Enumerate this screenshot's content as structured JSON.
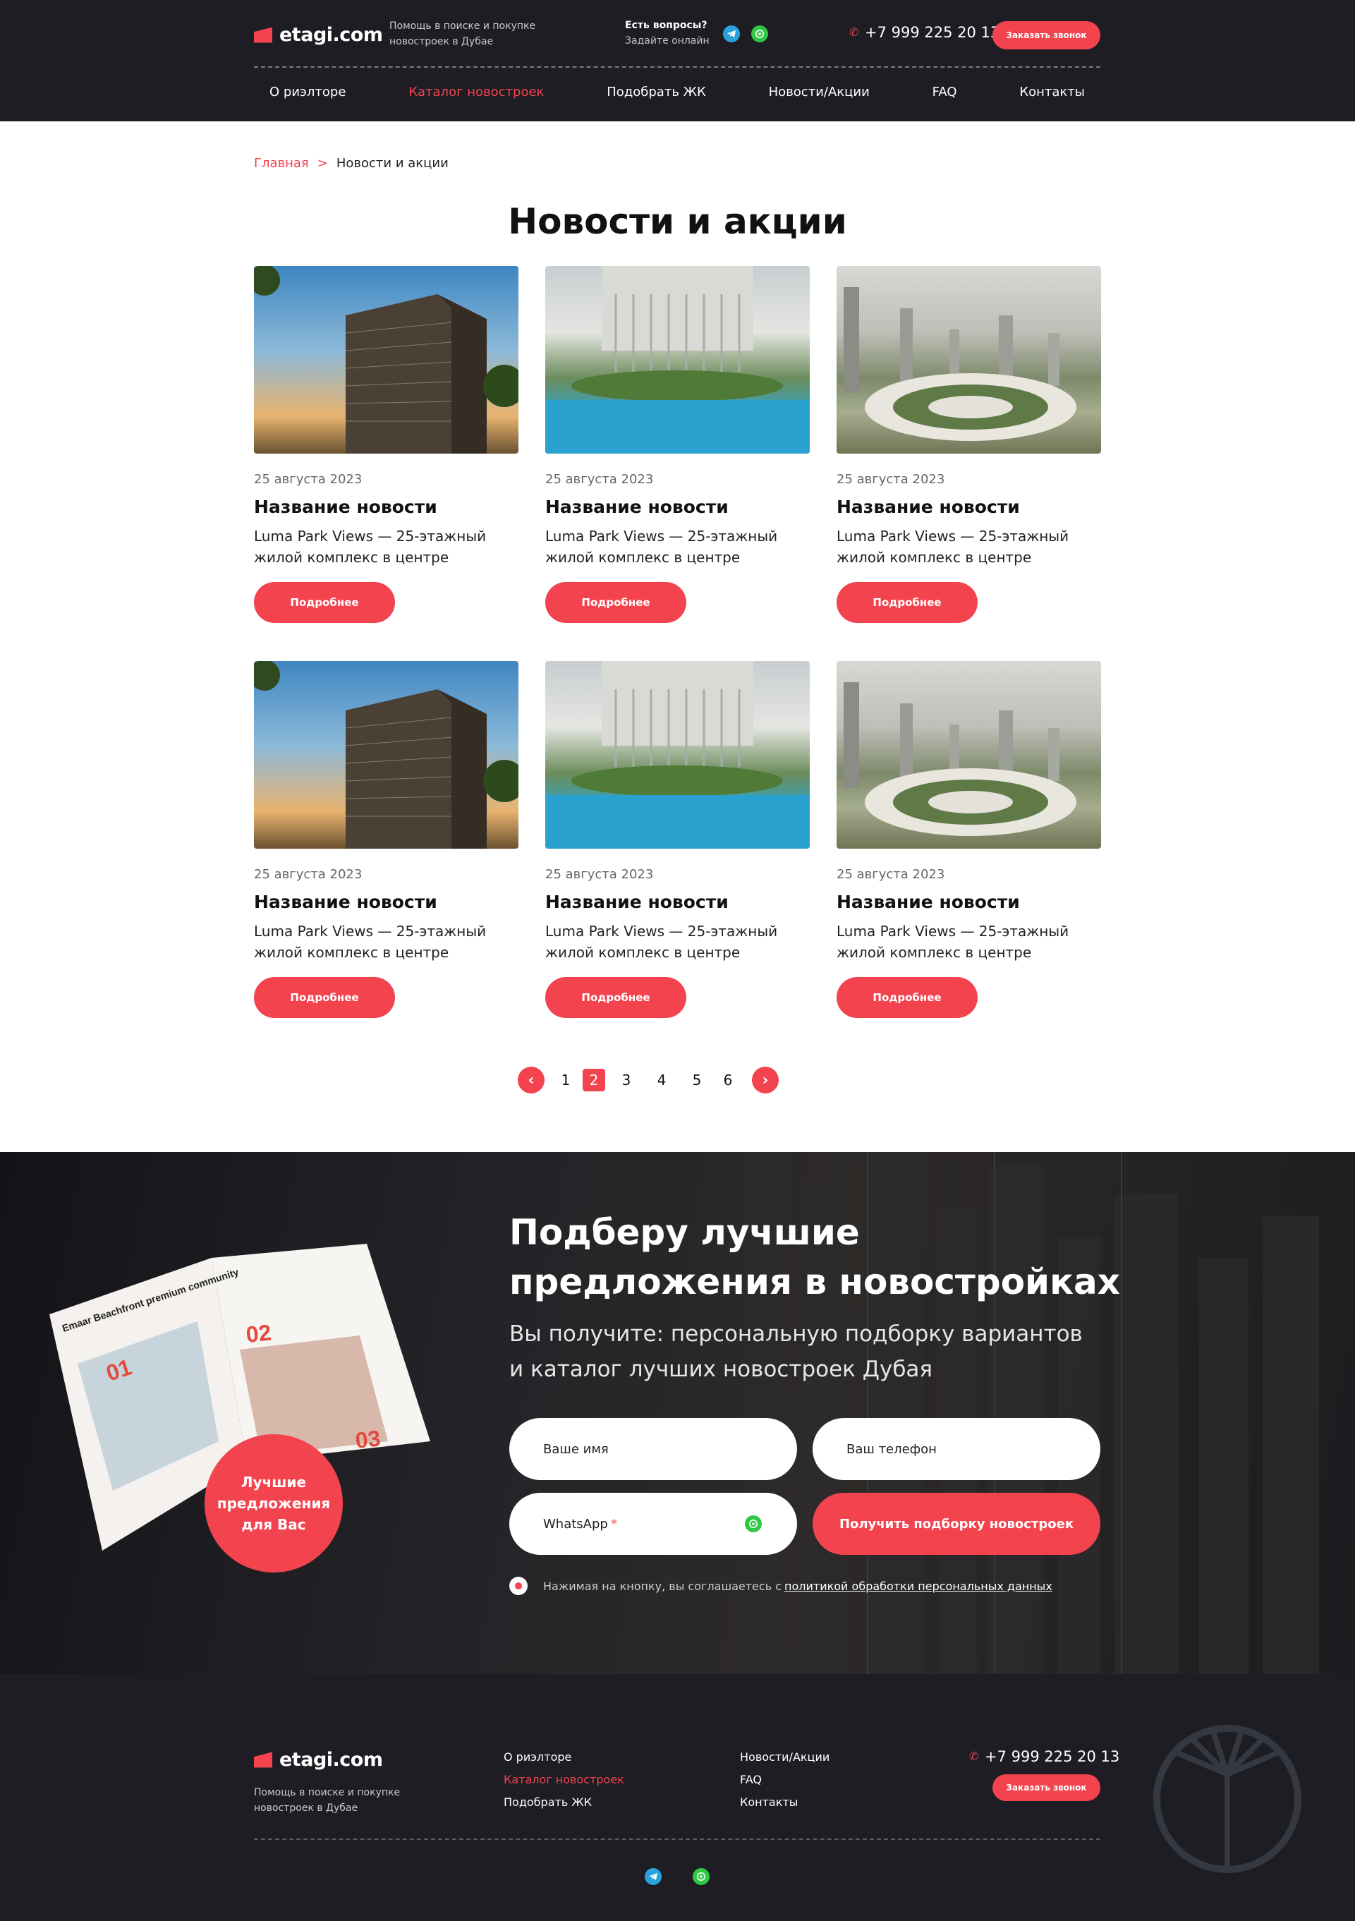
{
  "header": {
    "logo": "etagi.com",
    "tagline_1": "Помощь в поиске и покупке",
    "tagline_2": "новостроек в Дубае",
    "questions_title": "Есть вопросы?",
    "questions_sub": "Задайте онлайн",
    "phone": "+7 999 225 20 13",
    "callback_label": "Заказать звонок",
    "nav": [
      {
        "label": "О риэлторе",
        "active": false
      },
      {
        "label": "Каталог новостроек",
        "active": true
      },
      {
        "label": "Подобрать  ЖК",
        "active": false
      },
      {
        "label": "Новости/Акции",
        "active": false
      },
      {
        "label": "FAQ",
        "active": false
      },
      {
        "label": "Контакты",
        "active": false
      }
    ]
  },
  "breadcrumb": {
    "home": "Главная",
    "separator": ">",
    "current": "Новости и акции"
  },
  "page_title": "Новости и акции",
  "cards": [
    {
      "date": "25 августа 2023",
      "title": "Название новости",
      "desc_1": "Luma Park Views — 25-этажный",
      "desc_2": "жилой комплекс в центре",
      "button": "Подробнее",
      "image": "building-tower"
    },
    {
      "date": "25 августа 2023",
      "title": "Название новости",
      "desc_1": "Luma Park Views — 25-этажный",
      "desc_2": "жилой комплекс в центре",
      "button": "Подробнее",
      "image": "pool-tower"
    },
    {
      "date": "25 августа 2023",
      "title": "Название новости",
      "desc_1": "Luma Park Views — 25-этажный",
      "desc_2": "жилой комплекс в центре",
      "button": "Подробнее",
      "image": "city-aerial"
    },
    {
      "date": "25 августа 2023",
      "title": "Название новости",
      "desc_1": "Luma Park Views — 25-этажный",
      "desc_2": "жилой комплекс в центре",
      "button": "Подробнее",
      "image": "building-tower"
    },
    {
      "date": "25 августа 2023",
      "title": "Название новости",
      "desc_1": "Luma Park Views — 25-этажный",
      "desc_2": "жилой комплекс в центре",
      "button": "Подробнее",
      "image": "pool-tower"
    },
    {
      "date": "25 августа 2023",
      "title": "Название новости",
      "desc_1": "Luma Park Views — 25-этажный",
      "desc_2": "жилой комплекс в центре",
      "button": "Подробнее",
      "image": "city-aerial"
    }
  ],
  "pagination": {
    "pages": [
      "1",
      "2",
      "3",
      "4",
      "5",
      "6"
    ],
    "current": "2"
  },
  "promo": {
    "title_1": "Подберу лучшие",
    "title_2": "предложения в новостройках",
    "sub_1": "Вы получите: персональную подборку вариантов",
    "sub_2": "и каталог лучших новостроек Дубая",
    "name_placeholder": "Ваше имя",
    "phone_placeholder": "Ваш телефон",
    "whatsapp_placeholder": "WhatsApp",
    "required_mark": "*",
    "submit_label": "Получить подборку новостроек",
    "agree_text": "Нажимая на кнопку, вы соглашаетесь с",
    "agree_link": "политикой обработки персональных данных",
    "badge_1": "Лучшие",
    "badge_2": "предложения",
    "badge_3": "для Вас",
    "magazine_heading": "Emaar Beachfront premium community",
    "magazine_01": "01",
    "magazine_02": "02",
    "magazine_03": "03"
  },
  "footer": {
    "logo": "etagi.com",
    "tagline_1": "Помощь в поиске и покупке",
    "tagline_2": "новостроек в Дубае",
    "col1": [
      {
        "label": "О риэлторе",
        "active": false
      },
      {
        "label": "Каталог новостроек",
        "active": true
      },
      {
        "label": "Подобрать  ЖК",
        "active": false
      }
    ],
    "col2": [
      {
        "label": "Новости/Акции",
        "active": false
      },
      {
        "label": "FAQ",
        "active": false
      },
      {
        "label": "Контакты",
        "active": false
      }
    ],
    "phone": "+7 999 225 20 13",
    "callback_label": "Заказать звонок"
  },
  "colors": {
    "accent": "#f3434f",
    "dark": "#1d1d23",
    "telegram": "#2aa3dd",
    "whatsapp": "#2fc845"
  }
}
